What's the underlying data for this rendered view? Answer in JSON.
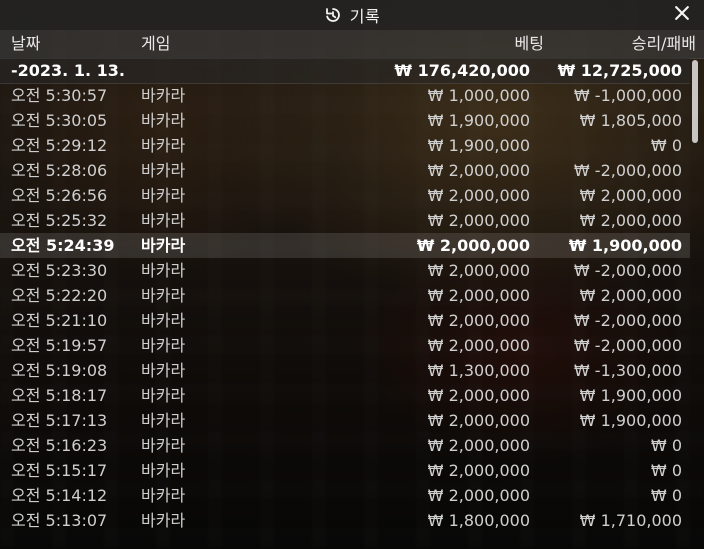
{
  "title": {
    "icon": "history-clock-icon",
    "text": "기록"
  },
  "close": {
    "icon": "close-icon",
    "label": "Close"
  },
  "columns": {
    "date": "날짜",
    "game": "게임",
    "bet": "베팅",
    "result": "승리/패배"
  },
  "summary_row": {
    "date": "-2023. 1. 13.",
    "game": "",
    "bet": "₩ 176,420,000",
    "result": "₩ 12,725,000"
  },
  "rows": [
    {
      "date": "오전 5:30:57",
      "game": "바카라",
      "bet": "₩ 1,000,000",
      "result": "₩ -1,000,000"
    },
    {
      "date": "오전 5:30:05",
      "game": "바카라",
      "bet": "₩ 1,900,000",
      "result": "₩ 1,805,000"
    },
    {
      "date": "오전 5:29:12",
      "game": "바카라",
      "bet": "₩ 1,900,000",
      "result": "₩ 0"
    },
    {
      "date": "오전 5:28:06",
      "game": "바카라",
      "bet": "₩ 2,000,000",
      "result": "₩ -2,000,000"
    },
    {
      "date": "오전 5:26:56",
      "game": "바카라",
      "bet": "₩ 2,000,000",
      "result": "₩ 2,000,000"
    },
    {
      "date": "오전 5:25:32",
      "game": "바카라",
      "bet": "₩ 2,000,000",
      "result": "₩ 2,000,000"
    },
    {
      "date": "오전 5:24:39",
      "game": "바카라",
      "bet": "₩ 2,000,000",
      "result": "₩ 1,900,000"
    },
    {
      "date": "오전 5:23:30",
      "game": "바카라",
      "bet": "₩ 2,000,000",
      "result": "₩ -2,000,000"
    },
    {
      "date": "오전 5:22:20",
      "game": "바카라",
      "bet": "₩ 2,000,000",
      "result": "₩ 2,000,000"
    },
    {
      "date": "오전 5:21:10",
      "game": "바카라",
      "bet": "₩ 2,000,000",
      "result": "₩ -2,000,000"
    },
    {
      "date": "오전 5:19:57",
      "game": "바카라",
      "bet": "₩ 2,000,000",
      "result": "₩ -2,000,000"
    },
    {
      "date": "오전 5:19:08",
      "game": "바카라",
      "bet": "₩ 1,300,000",
      "result": "₩ -1,300,000"
    },
    {
      "date": "오전 5:18:17",
      "game": "바카라",
      "bet": "₩ 2,000,000",
      "result": "₩ 1,900,000"
    },
    {
      "date": "오전 5:17:13",
      "game": "바카라",
      "bet": "₩ 2,000,000",
      "result": "₩ 1,900,000"
    },
    {
      "date": "오전 5:16:23",
      "game": "바카라",
      "bet": "₩ 2,000,000",
      "result": "₩ 0"
    },
    {
      "date": "오전 5:15:17",
      "game": "바카라",
      "bet": "₩ 2,000,000",
      "result": "₩ 0"
    },
    {
      "date": "오전 5:14:12",
      "game": "바카라",
      "bet": "₩ 2,000,000",
      "result": "₩ 0"
    },
    {
      "date": "오전 5:13:07",
      "game": "바카라",
      "bet": "₩ 1,800,000",
      "result": "₩ 1,710,000"
    }
  ],
  "highlighted_row_index": 6
}
